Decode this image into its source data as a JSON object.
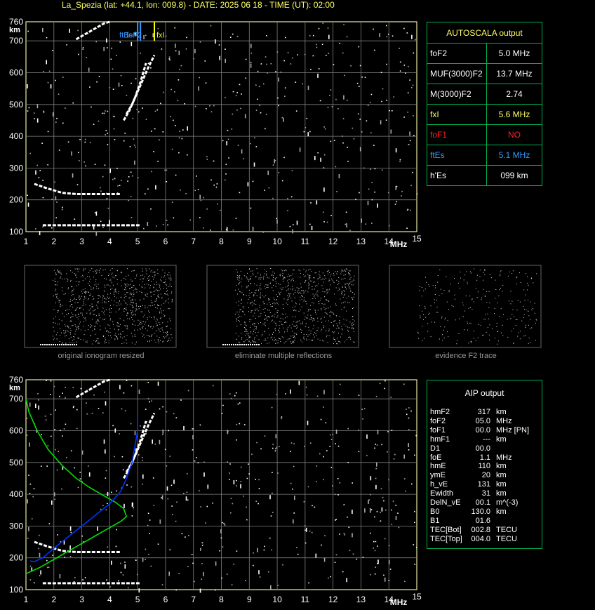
{
  "header": {
    "title": "La_Spezia (lat: +44.1, lon: 009.8) - DATE: 2025 06 18 - TIME (UT): 02:00"
  },
  "chart_data": [
    {
      "type": "scatter",
      "title": "",
      "xlabel": "MHz",
      "ylabel": "km",
      "xlim": [
        1,
        15
      ],
      "ylim": [
        100,
        760
      ],
      "xticks": [
        1,
        2,
        3,
        4,
        5,
        6,
        7,
        8,
        9,
        10,
        11,
        12,
        13,
        14,
        15
      ],
      "yticks": [
        100,
        200,
        300,
        400,
        500,
        600,
        700,
        760
      ],
      "grid": true,
      "markers": [
        {
          "label": "ftEs",
          "x": 5.1,
          "color": "#3399ff"
        },
        {
          "label": "foF2",
          "x": 5.0,
          "color": "#3399ff"
        },
        {
          "label": "fxI",
          "x": 5.6,
          "color": "#ffff00"
        }
      ],
      "series": [
        {
          "points": [
            [
              1.6,
              120
            ],
            [
              2.0,
              120
            ],
            [
              2.5,
              120
            ],
            [
              3.0,
              120
            ],
            [
              3.5,
              120
            ],
            [
              4.0,
              120
            ],
            [
              4.5,
              120
            ],
            [
              5.1,
              120
            ]
          ]
        },
        {
          "points": [
            [
              1.3,
              250
            ],
            [
              1.8,
              235
            ],
            [
              2.3,
              222
            ],
            [
              2.8,
              218
            ],
            [
              3.3,
              218
            ],
            [
              3.8,
              218
            ],
            [
              4.4,
              218
            ]
          ]
        },
        {
          "points": [
            [
              4.5,
              450
            ],
            [
              4.7,
              480
            ],
            [
              4.9,
              520
            ],
            [
              5.1,
              570
            ],
            [
              5.2,
              600
            ],
            [
              5.3,
              630
            ]
          ]
        },
        {
          "points": [
            [
              4.6,
              470
            ],
            [
              4.8,
              500
            ],
            [
              5.0,
              540
            ],
            [
              5.2,
              580
            ],
            [
              5.4,
              620
            ],
            [
              5.6,
              655
            ]
          ]
        },
        {
          "points": [
            [
              2.8,
              705
            ],
            [
              3.0,
              715
            ],
            [
              3.4,
              735
            ],
            [
              3.8,
              755
            ],
            [
              4.0,
              760
            ]
          ]
        }
      ]
    },
    {
      "type": "line",
      "title": "",
      "xlabel": "MHz",
      "ylabel": "km",
      "xlim": [
        1,
        15
      ],
      "ylim": [
        100,
        760
      ],
      "grid": true,
      "series": [
        {
          "points": [
            [
              1.6,
              120
            ],
            [
              2.0,
              120
            ],
            [
              2.5,
              120
            ],
            [
              3.0,
              120
            ],
            [
              3.5,
              120
            ],
            [
              4.0,
              120
            ],
            [
              4.5,
              120
            ],
            [
              5.1,
              120
            ]
          ]
        },
        {
          "points": [
            [
              1.3,
              250
            ],
            [
              1.8,
              235
            ],
            [
              2.3,
              222
            ],
            [
              2.8,
              218
            ],
            [
              3.3,
              218
            ],
            [
              3.8,
              218
            ],
            [
              4.4,
              218
            ]
          ]
        },
        {
          "points": [
            [
              4.5,
              450
            ],
            [
              4.7,
              480
            ],
            [
              4.9,
              520
            ],
            [
              5.1,
              570
            ],
            [
              5.2,
              600
            ],
            [
              5.3,
              630
            ]
          ]
        },
        {
          "points": [
            [
              4.6,
              470
            ],
            [
              4.8,
              500
            ],
            [
              5.0,
              540
            ],
            [
              5.2,
              580
            ],
            [
              5.4,
              620
            ],
            [
              5.6,
              655
            ]
          ]
        },
        {
          "points": [
            [
              2.8,
              705
            ],
            [
              3.0,
              715
            ],
            [
              3.4,
              735
            ],
            [
              3.8,
              755
            ],
            [
              4.0,
              760
            ]
          ]
        },
        {
          "color": "#00e000",
          "points": [
            [
              1.0,
              150
            ],
            [
              1.5,
              170
            ],
            [
              2.0,
              195
            ],
            [
              2.5,
              220
            ],
            [
              3.0,
              245
            ],
            [
              3.5,
              270
            ],
            [
              4.0,
              295
            ],
            [
              4.4,
              315
            ],
            [
              4.6,
              330
            ],
            [
              4.5,
              355
            ],
            [
              4.2,
              375
            ],
            [
              3.8,
              395
            ],
            [
              3.3,
              420
            ],
            [
              2.8,
              450
            ],
            [
              2.3,
              490
            ],
            [
              1.8,
              540
            ],
            [
              1.4,
              600
            ],
            [
              1.1,
              660
            ],
            [
              1.0,
              700
            ]
          ]
        },
        {
          "color": "#0033ff",
          "points": [
            [
              1.15,
              190
            ],
            [
              1.3,
              188
            ],
            [
              1.6,
              200
            ],
            [
              2.0,
              230
            ],
            [
              2.5,
              265
            ],
            [
              3.0,
              300
            ],
            [
              3.5,
              335
            ],
            [
              4.0,
              370
            ],
            [
              4.4,
              410
            ],
            [
              4.6,
              450
            ],
            [
              4.8,
              500
            ],
            [
              4.9,
              550
            ],
            [
              5.0,
              600
            ],
            [
              5.0,
              640
            ]
          ]
        }
      ]
    }
  ],
  "autoscala": {
    "title": "AUTOSCALA output",
    "rows": [
      {
        "label": "foF2",
        "value": "5.0 MHz",
        "color": "#ffffff"
      },
      {
        "label": "MUF(3000)F2",
        "value": "13.7 MHz",
        "color": "#ffffff"
      },
      {
        "label": "M(3000)F2",
        "value": "2.74",
        "color": "#ffffff"
      },
      {
        "label": "fxI",
        "value": "5.6 MHz",
        "color": "#ffff66"
      },
      {
        "label": "foF1",
        "value": "NO",
        "color": "#ff2020"
      },
      {
        "label": "ftEs",
        "value": "5.1 MHz",
        "color": "#3399ff"
      },
      {
        "label": "h'Es",
        "value": "099     km",
        "color": "#ffffff"
      }
    ]
  },
  "thumbnails": [
    {
      "caption": "original ionogram resized"
    },
    {
      "caption": "eliminate multiple reflections"
    },
    {
      "caption": "evidence F2 trace"
    }
  ],
  "aip": {
    "title": "AIP output",
    "rows": [
      {
        "label": "hmF2",
        "value": "317",
        "unit": "km"
      },
      {
        "label": "foF2",
        "value": "05.0",
        "unit": "MHz"
      },
      {
        "label": "foF1",
        "value": "00.0",
        "unit": "MHz   [PN]"
      },
      {
        "label": "hmF1",
        "value": "---",
        "unit": "km"
      },
      {
        "label": "D1",
        "value": "00.0",
        "unit": ""
      },
      {
        "label": "foE",
        "value": "1.1",
        "unit": "MHz"
      },
      {
        "label": "hmE",
        "value": "110",
        "unit": "km"
      },
      {
        "label": "ymE",
        "value": "20",
        "unit": "km"
      },
      {
        "label": "h_vE",
        "value": "131",
        "unit": "km"
      },
      {
        "label": "Ewidth",
        "value": "31",
        "unit": "km"
      },
      {
        "label": "DelN_vE",
        "value": "00.1",
        "unit": "m^(-3)"
      },
      {
        "label": "B0",
        "value": "130.0",
        "unit": "km"
      },
      {
        "label": "B1",
        "value": "01.6",
        "unit": ""
      },
      {
        "label": "TEC[Bot]",
        "value": "002.8",
        "unit": "TECU"
      },
      {
        "label": "TEC[Top]",
        "value": "004.0",
        "unit": "TECU"
      }
    ]
  }
}
